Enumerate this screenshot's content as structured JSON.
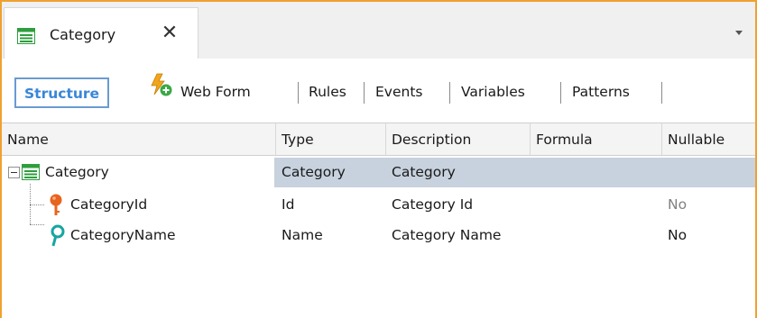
{
  "window": {
    "tab": {
      "label": "Category",
      "icon": "transaction-grid-icon",
      "close_glyph": "✕"
    },
    "overflow_glyph": "▾"
  },
  "subtabs": [
    {
      "label": "Structure",
      "active": true
    },
    {
      "label": "Web Form",
      "icon": "webform-icon"
    },
    {
      "label": "Rules"
    },
    {
      "label": "Events"
    },
    {
      "label": "Variables"
    },
    {
      "label": "Patterns"
    }
  ],
  "grid": {
    "columns": [
      "Name",
      "Type",
      "Description",
      "Formula",
      "Nullable"
    ],
    "rows": [
      {
        "name": "Category",
        "type": "Category",
        "description": "Category",
        "formula": "",
        "nullable": "",
        "icon": "level-grid-icon",
        "level": 0,
        "selected": true
      },
      {
        "name": "CategoryId",
        "type": "Id",
        "description": "Category Id",
        "formula": "",
        "nullable": "No",
        "icon": "primary-key-icon",
        "level": 1,
        "nullable_muted": true
      },
      {
        "name": "CategoryName",
        "type": "Name",
        "description": "Category Name",
        "formula": "",
        "nullable": "No",
        "icon": "description-attribute-icon",
        "level": 1
      }
    ]
  },
  "colors": {
    "frame_accent": "#f0a030",
    "active_tab_text": "#3a86d8",
    "active_tab_border": "#6a9bd1",
    "selected_row": "#c7d2de",
    "primary_key_icon": "#e8641e",
    "description_icon": "#17a5a0",
    "grid_icon": "#2e9e3e"
  }
}
